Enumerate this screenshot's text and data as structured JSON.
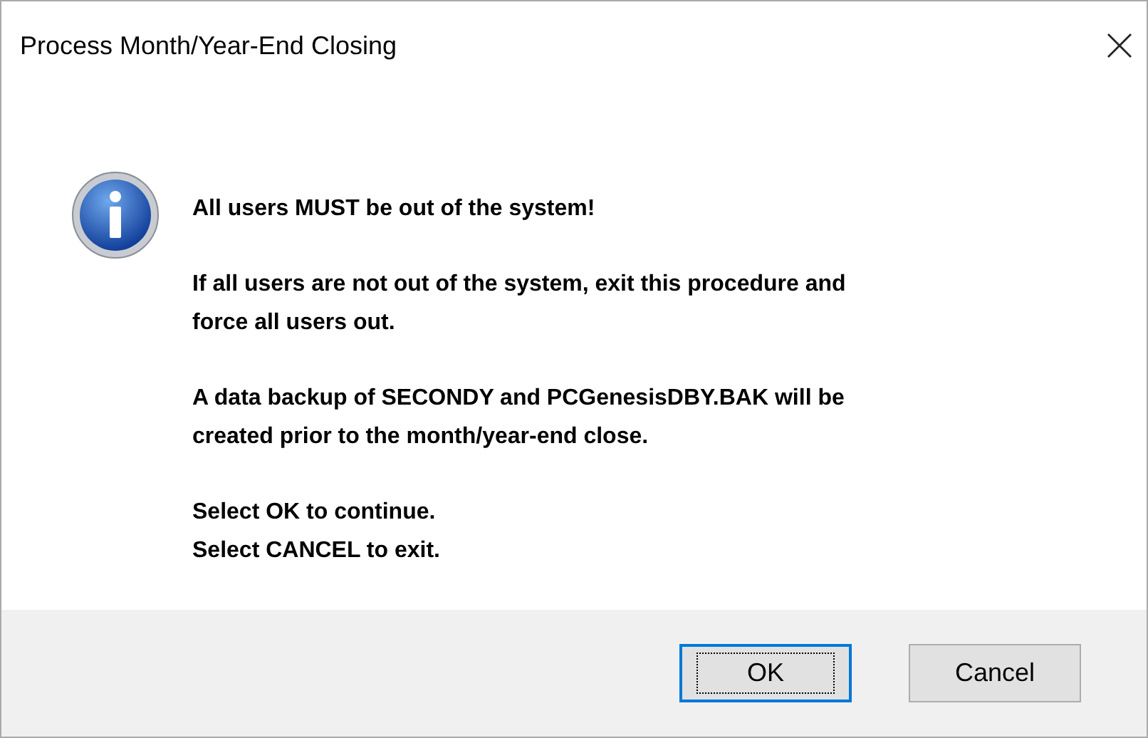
{
  "window": {
    "title": "Process Month/Year-End Closing"
  },
  "message": {
    "paragraphs": [
      [
        "All users MUST be out of the system!"
      ],
      [
        "If all users are not out of the system, exit this procedure and",
        "force all users out."
      ],
      [
        "A data backup of SECONDY and PCGenesisDBY.BAK will be",
        "created prior to the month/year-end close."
      ],
      [
        "Select OK to continue.",
        "Select CANCEL to exit."
      ]
    ]
  },
  "buttons": [
    {
      "label": "OK",
      "default": true
    },
    {
      "label": "Cancel",
      "default": false
    }
  ]
}
